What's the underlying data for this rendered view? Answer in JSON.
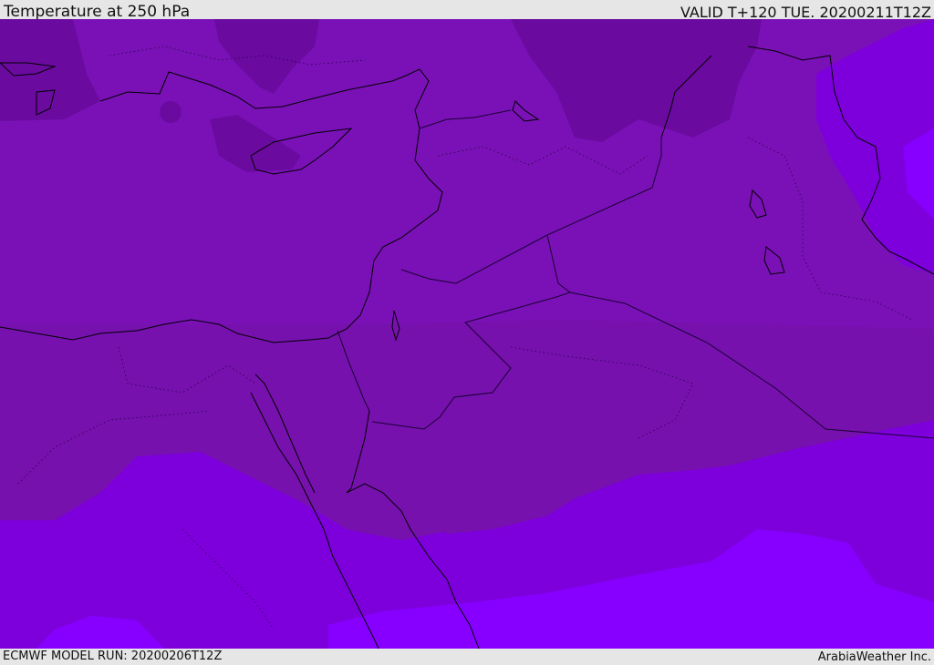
{
  "header": {
    "title": "Temperature at 250 hPa",
    "valid": "VALID T+120 TUE. 20200211T12Z"
  },
  "footer": {
    "model_run": "ECMWF MODEL RUN: 20200206T12Z",
    "brand": "ArabiaWeather Inc."
  },
  "map": {
    "field": "Temperature",
    "level": "250 hPa",
    "colors": {
      "background": "#7a11b6",
      "band_cold": "#6a0a9f",
      "band_mid": "#7611ad",
      "band_warm": "#7d00dc",
      "band_warmer": "#8700ff",
      "band_warmest": "#7e2cff",
      "coastline": "#000000",
      "border": "#1a0033"
    }
  }
}
